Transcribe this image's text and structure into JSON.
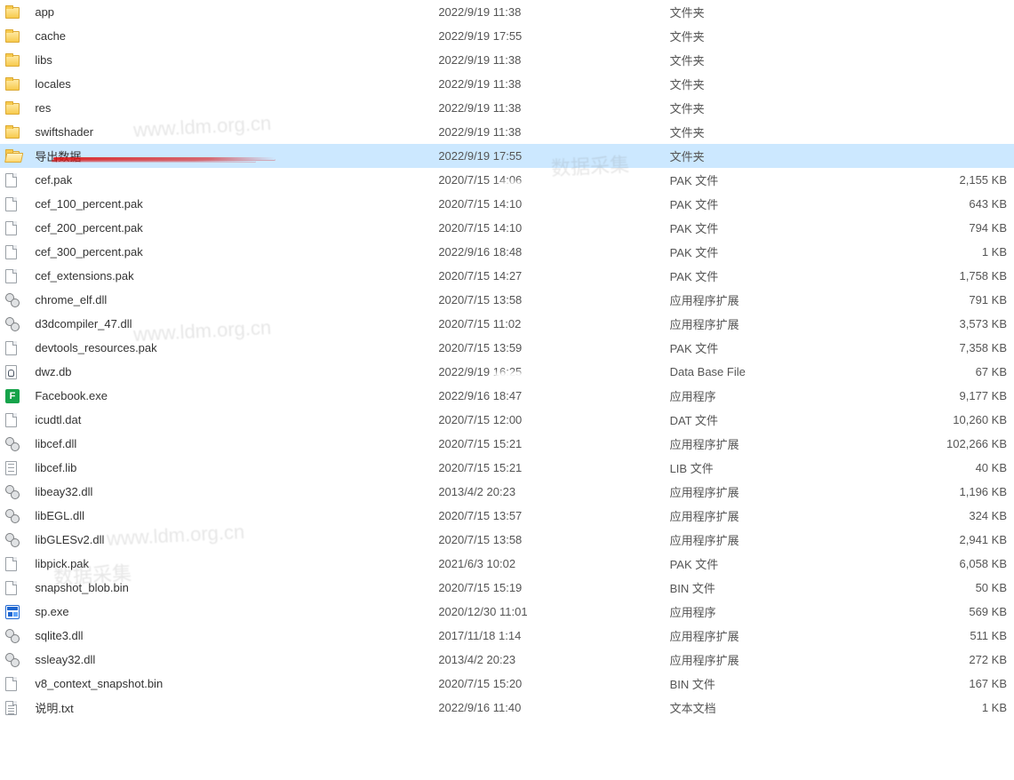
{
  "files": [
    {
      "name": "app",
      "date": "2022/9/19 11:38",
      "type": "文件夹",
      "size": "",
      "icon": "folder"
    },
    {
      "name": "cache",
      "date": "2022/9/19 17:55",
      "type": "文件夹",
      "size": "",
      "icon": "folder"
    },
    {
      "name": "libs",
      "date": "2022/9/19 11:38",
      "type": "文件夹",
      "size": "",
      "icon": "folder"
    },
    {
      "name": "locales",
      "date": "2022/9/19 11:38",
      "type": "文件夹",
      "size": "",
      "icon": "folder"
    },
    {
      "name": "res",
      "date": "2022/9/19 11:38",
      "type": "文件夹",
      "size": "",
      "icon": "folder"
    },
    {
      "name": "swiftshader",
      "date": "2022/9/19 11:38",
      "type": "文件夹",
      "size": "",
      "icon": "folder"
    },
    {
      "name": "导出数据",
      "date": "2022/9/19 17:55",
      "type": "文件夹",
      "size": "",
      "icon": "folder-open",
      "selected": true
    },
    {
      "name": "cef.pak",
      "date": "2020/7/15 14:06",
      "type": "PAK 文件",
      "size": "2,155 KB",
      "icon": "file"
    },
    {
      "name": "cef_100_percent.pak",
      "date": "2020/7/15 14:10",
      "type": "PAK 文件",
      "size": "643 KB",
      "icon": "file"
    },
    {
      "name": "cef_200_percent.pak",
      "date": "2020/7/15 14:10",
      "type": "PAK 文件",
      "size": "794 KB",
      "icon": "file"
    },
    {
      "name": "cef_300_percent.pak",
      "date": "2022/9/16 18:48",
      "type": "PAK 文件",
      "size": "1 KB",
      "icon": "file"
    },
    {
      "name": "cef_extensions.pak",
      "date": "2020/7/15 14:27",
      "type": "PAK 文件",
      "size": "1,758 KB",
      "icon": "file"
    },
    {
      "name": "chrome_elf.dll",
      "date": "2020/7/15 13:58",
      "type": "应用程序扩展",
      "size": "791 KB",
      "icon": "dll"
    },
    {
      "name": "d3dcompiler_47.dll",
      "date": "2020/7/15 11:02",
      "type": "应用程序扩展",
      "size": "3,573 KB",
      "icon": "dll"
    },
    {
      "name": "devtools_resources.pak",
      "date": "2020/7/15 13:59",
      "type": "PAK 文件",
      "size": "7,358 KB",
      "icon": "file"
    },
    {
      "name": "dwz.db",
      "date": "2022/9/19 16:25",
      "type": "Data Base File",
      "size": "67 KB",
      "icon": "db"
    },
    {
      "name": "Facebook.exe",
      "date": "2022/9/16 18:47",
      "type": "应用程序",
      "size": "9,177 KB",
      "icon": "exe-f"
    },
    {
      "name": "icudtl.dat",
      "date": "2020/7/15 12:00",
      "type": "DAT 文件",
      "size": "10,260 KB",
      "icon": "dat"
    },
    {
      "name": "libcef.dll",
      "date": "2020/7/15 15:21",
      "type": "应用程序扩展",
      "size": "102,266 KB",
      "icon": "dll"
    },
    {
      "name": "libcef.lib",
      "date": "2020/7/15 15:21",
      "type": "LIB 文件",
      "size": "40 KB",
      "icon": "lib"
    },
    {
      "name": "libeay32.dll",
      "date": "2013/4/2 20:23",
      "type": "应用程序扩展",
      "size": "1,196 KB",
      "icon": "dll"
    },
    {
      "name": "libEGL.dll",
      "date": "2020/7/15 13:57",
      "type": "应用程序扩展",
      "size": "324 KB",
      "icon": "dll"
    },
    {
      "name": "libGLESv2.dll",
      "date": "2020/7/15 13:58",
      "type": "应用程序扩展",
      "size": "2,941 KB",
      "icon": "dll"
    },
    {
      "name": "libpick.pak",
      "date": "2021/6/3 10:02",
      "type": "PAK 文件",
      "size": "6,058 KB",
      "icon": "file"
    },
    {
      "name": "snapshot_blob.bin",
      "date": "2020/7/15 15:19",
      "type": "BIN 文件",
      "size": "50 KB",
      "icon": "file"
    },
    {
      "name": "sp.exe",
      "date": "2020/12/30 11:01",
      "type": "应用程序",
      "size": "569 KB",
      "icon": "exe-sp"
    },
    {
      "name": "sqlite3.dll",
      "date": "2017/11/18 1:14",
      "type": "应用程序扩展",
      "size": "511 KB",
      "icon": "dll"
    },
    {
      "name": "ssleay32.dll",
      "date": "2013/4/2 20:23",
      "type": "应用程序扩展",
      "size": "272 KB",
      "icon": "dll"
    },
    {
      "name": "v8_context_snapshot.bin",
      "date": "2020/7/15 15:20",
      "type": "BIN 文件",
      "size": "167 KB",
      "icon": "file"
    },
    {
      "name": "说明.txt",
      "date": "2022/9/16 11:40",
      "type": "文本文档",
      "size": "1 KB",
      "icon": "txt"
    }
  ],
  "watermarks": [
    "www.ldm.org.cn",
    "数据采集"
  ]
}
